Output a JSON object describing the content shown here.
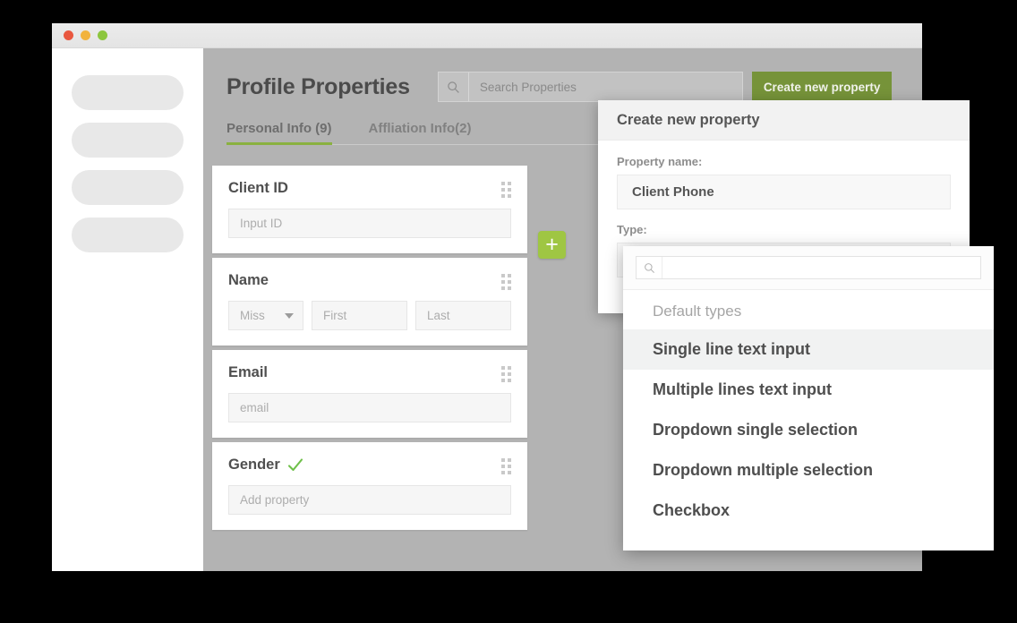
{
  "window": {
    "traffic_lights": [
      "close-red",
      "minimize-yellow",
      "zoom-green"
    ]
  },
  "sidebar": {
    "placeholder_items": [
      "",
      "",
      "",
      ""
    ]
  },
  "header": {
    "page_title": "Profile Properties",
    "search": {
      "icon": "search-icon",
      "placeholder": "Search Properties",
      "value": ""
    },
    "create_button_label": "Create new property",
    "create_button_color": "#769339"
  },
  "tabs": [
    {
      "label": "Personal Info (9)",
      "active": true
    },
    {
      "label": "Affliation Info(2)",
      "active": false
    }
  ],
  "tab_accent_color": "#8ab140",
  "cards": [
    {
      "title": "Client ID",
      "verified": false,
      "handle_icon": "drag-handle-icon",
      "fields": [
        {
          "kind": "text",
          "placeholder": "Input ID"
        }
      ]
    },
    {
      "title": "Name",
      "verified": false,
      "handle_icon": "drag-handle-icon",
      "fields": [
        {
          "kind": "select",
          "value": "Miss",
          "icon": "chevron-down-icon"
        },
        {
          "kind": "text",
          "placeholder": "First"
        },
        {
          "kind": "text",
          "placeholder": "Last"
        }
      ]
    },
    {
      "title": "Email",
      "verified": false,
      "handle_icon": "drag-handle-icon",
      "fields": [
        {
          "kind": "text",
          "placeholder": "email"
        }
      ]
    },
    {
      "title": "Gender",
      "verified": true,
      "verified_icon": "check-icon",
      "handle_icon": "drag-handle-icon",
      "fields": [
        {
          "kind": "text",
          "placeholder": "Add property"
        }
      ]
    }
  ],
  "add_button": {
    "icon": "plus-icon",
    "label": "+",
    "color": "#9fc643"
  },
  "modal": {
    "title": "Create new property",
    "property_name_label": "Property name:",
    "property_name_value": "Client Phone",
    "type_label": "Type:",
    "type_value": ""
  },
  "type_dropdown": {
    "search": {
      "icon": "search-icon",
      "value": "",
      "placeholder": ""
    },
    "group_label": "Default types",
    "options": [
      {
        "label": "Single line text input",
        "highlighted": true
      },
      {
        "label": "Multiple lines text input",
        "highlighted": false
      },
      {
        "label": "Dropdown single selection",
        "highlighted": false
      },
      {
        "label": "Dropdown multiple selection",
        "highlighted": false
      },
      {
        "label": "Checkbox",
        "highlighted": false
      }
    ]
  }
}
